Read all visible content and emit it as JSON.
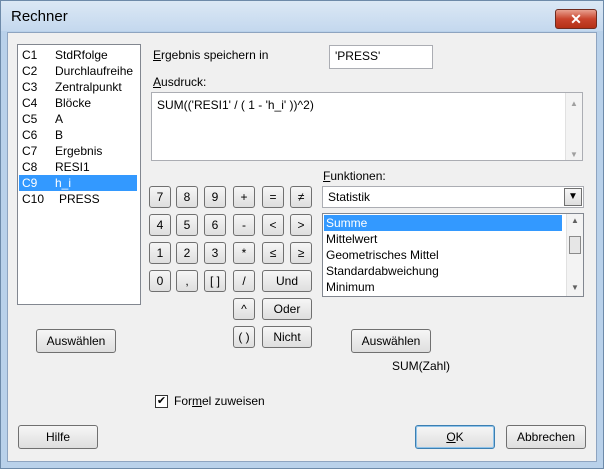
{
  "window": {
    "title": "Rechner",
    "close": "✕"
  },
  "columns": [
    {
      "id": "C1",
      "name": "StdRfolge"
    },
    {
      "id": "C2",
      "name": "Durchlaufreihe"
    },
    {
      "id": "C3",
      "name": "Zentralpunkt"
    },
    {
      "id": "C4",
      "name": "Blöcke"
    },
    {
      "id": "C5",
      "name": "A"
    },
    {
      "id": "C6",
      "name": "B"
    },
    {
      "id": "C7",
      "name": "Ergebnis"
    },
    {
      "id": "C8",
      "name": "RESI1"
    },
    {
      "id": "C9",
      "name": "h_i"
    },
    {
      "id": "C10",
      "name": "PRESS"
    }
  ],
  "selected_column": "C9",
  "store_label_pre": "E",
  "store_label_post": "rgebnis speichern in",
  "store_value": "'PRESS'",
  "expression_label_pre": "A",
  "expression_label_post": "usdruck:",
  "expression_value": "SUM(('RESI1' / ( 1 - 'h_i' ))^2)",
  "keypad": {
    "digits": [
      "7",
      "8",
      "9",
      "4",
      "5",
      "6",
      "1",
      "2",
      "3",
      "0",
      ",",
      "[ ]"
    ],
    "ops": [
      "+",
      "-",
      "*",
      "/",
      "^",
      "( )"
    ],
    "compare": [
      "=",
      "≠",
      "<",
      ">",
      "≤",
      "≥"
    ],
    "logic": [
      "Und",
      "Oder",
      "Nicht"
    ]
  },
  "functions_label_pre": "F",
  "functions_label_post": "unktionen:",
  "functions_category": "Statistik",
  "functions_list": [
    "Summe",
    "Mittelwert",
    "Geometrisches Mittel",
    "Standardabweichung",
    "Minimum"
  ],
  "selected_function": "Summe",
  "function_syntax": "SUM(Zahl)",
  "select_button": "Auswählen",
  "select_function_button": "Auswählen",
  "assign_formula_pre": "For",
  "assign_formula_u": "m",
  "assign_formula_post": "el zuweisen",
  "assign_formula_checked": true,
  "buttons": {
    "help": "Hilfe",
    "ok_u": "O",
    "ok_post": "K",
    "cancel": "Abbrechen"
  }
}
